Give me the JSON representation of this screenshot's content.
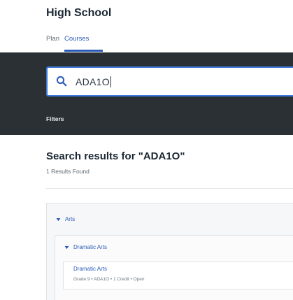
{
  "header": {
    "title": "High School",
    "tabs": [
      {
        "label": "Plan",
        "active": false
      },
      {
        "label": "Courses",
        "active": true
      }
    ]
  },
  "search": {
    "value": "ADA1O",
    "filters_label": "Filters"
  },
  "results": {
    "title": "Search results for \"ADA1O\"",
    "count_text": "1 Results Found",
    "groups": [
      {
        "label": "Arts",
        "subgroups": [
          {
            "label": "Dramatic Arts",
            "courses": [
              {
                "title": "Dramatic Arts",
                "meta": "Grade 9 • ADA1O • 1 Credit • Open"
              }
            ]
          }
        ]
      }
    ]
  },
  "colors": {
    "accent": "#2b5db8",
    "search_band": "#2b3034",
    "focus_border": "#3b78d8"
  },
  "icons": {
    "search": "search-icon",
    "expand": "chevron-down-icon"
  }
}
